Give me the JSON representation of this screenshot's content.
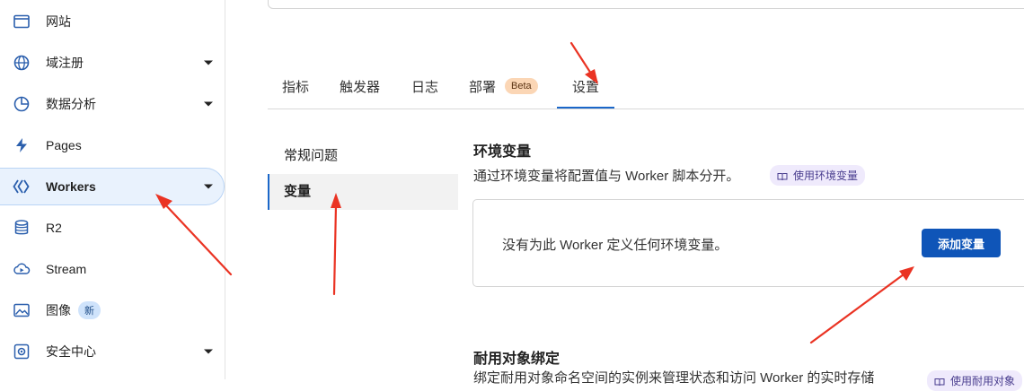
{
  "sidebar": {
    "items": [
      {
        "label": "网站",
        "icon": "browser-window-icon",
        "caret": false
      },
      {
        "label": "域注册",
        "icon": "globe-icon",
        "caret": true
      },
      {
        "label": "数据分析",
        "icon": "pie-chart-icon",
        "caret": true
      },
      {
        "label": "Pages",
        "icon": "lightning-icon",
        "caret": false
      },
      {
        "label": "Workers",
        "icon": "workers-diamond-icon",
        "caret": true,
        "active": true
      },
      {
        "label": "R2",
        "icon": "database-icon",
        "caret": false
      },
      {
        "label": "Stream",
        "icon": "cloud-play-icon",
        "caret": false
      },
      {
        "label": "图像",
        "icon": "image-icon",
        "caret": false,
        "badge": "新"
      },
      {
        "label": "安全中心",
        "icon": "gear-shield-icon",
        "caret": true
      }
    ]
  },
  "tabs": [
    {
      "label": "指标"
    },
    {
      "label": "触发器"
    },
    {
      "label": "日志"
    },
    {
      "label": "部署",
      "badge": "Beta"
    },
    {
      "label": "设置",
      "active": true
    }
  ],
  "subnav": [
    {
      "label": "常规问题"
    },
    {
      "label": "变量",
      "active": true
    }
  ],
  "env": {
    "title": "环境变量",
    "description": "通过环境变量将配置值与 Worker 脚本分开。",
    "doc_link": "使用环境变量",
    "empty_text": "没有为此 Worker 定义任何环境变量。",
    "add_button": "添加变量"
  },
  "durable": {
    "title": "耐用对象绑定",
    "description": "绑定耐用对象命名空间的实例来管理状态和访问 Worker 的实时存储",
    "doc_link": "使用耐用对象"
  },
  "colors": {
    "accent": "#1b67c9",
    "button": "#0f55b8",
    "annotation_arrow": "#ea3323"
  }
}
